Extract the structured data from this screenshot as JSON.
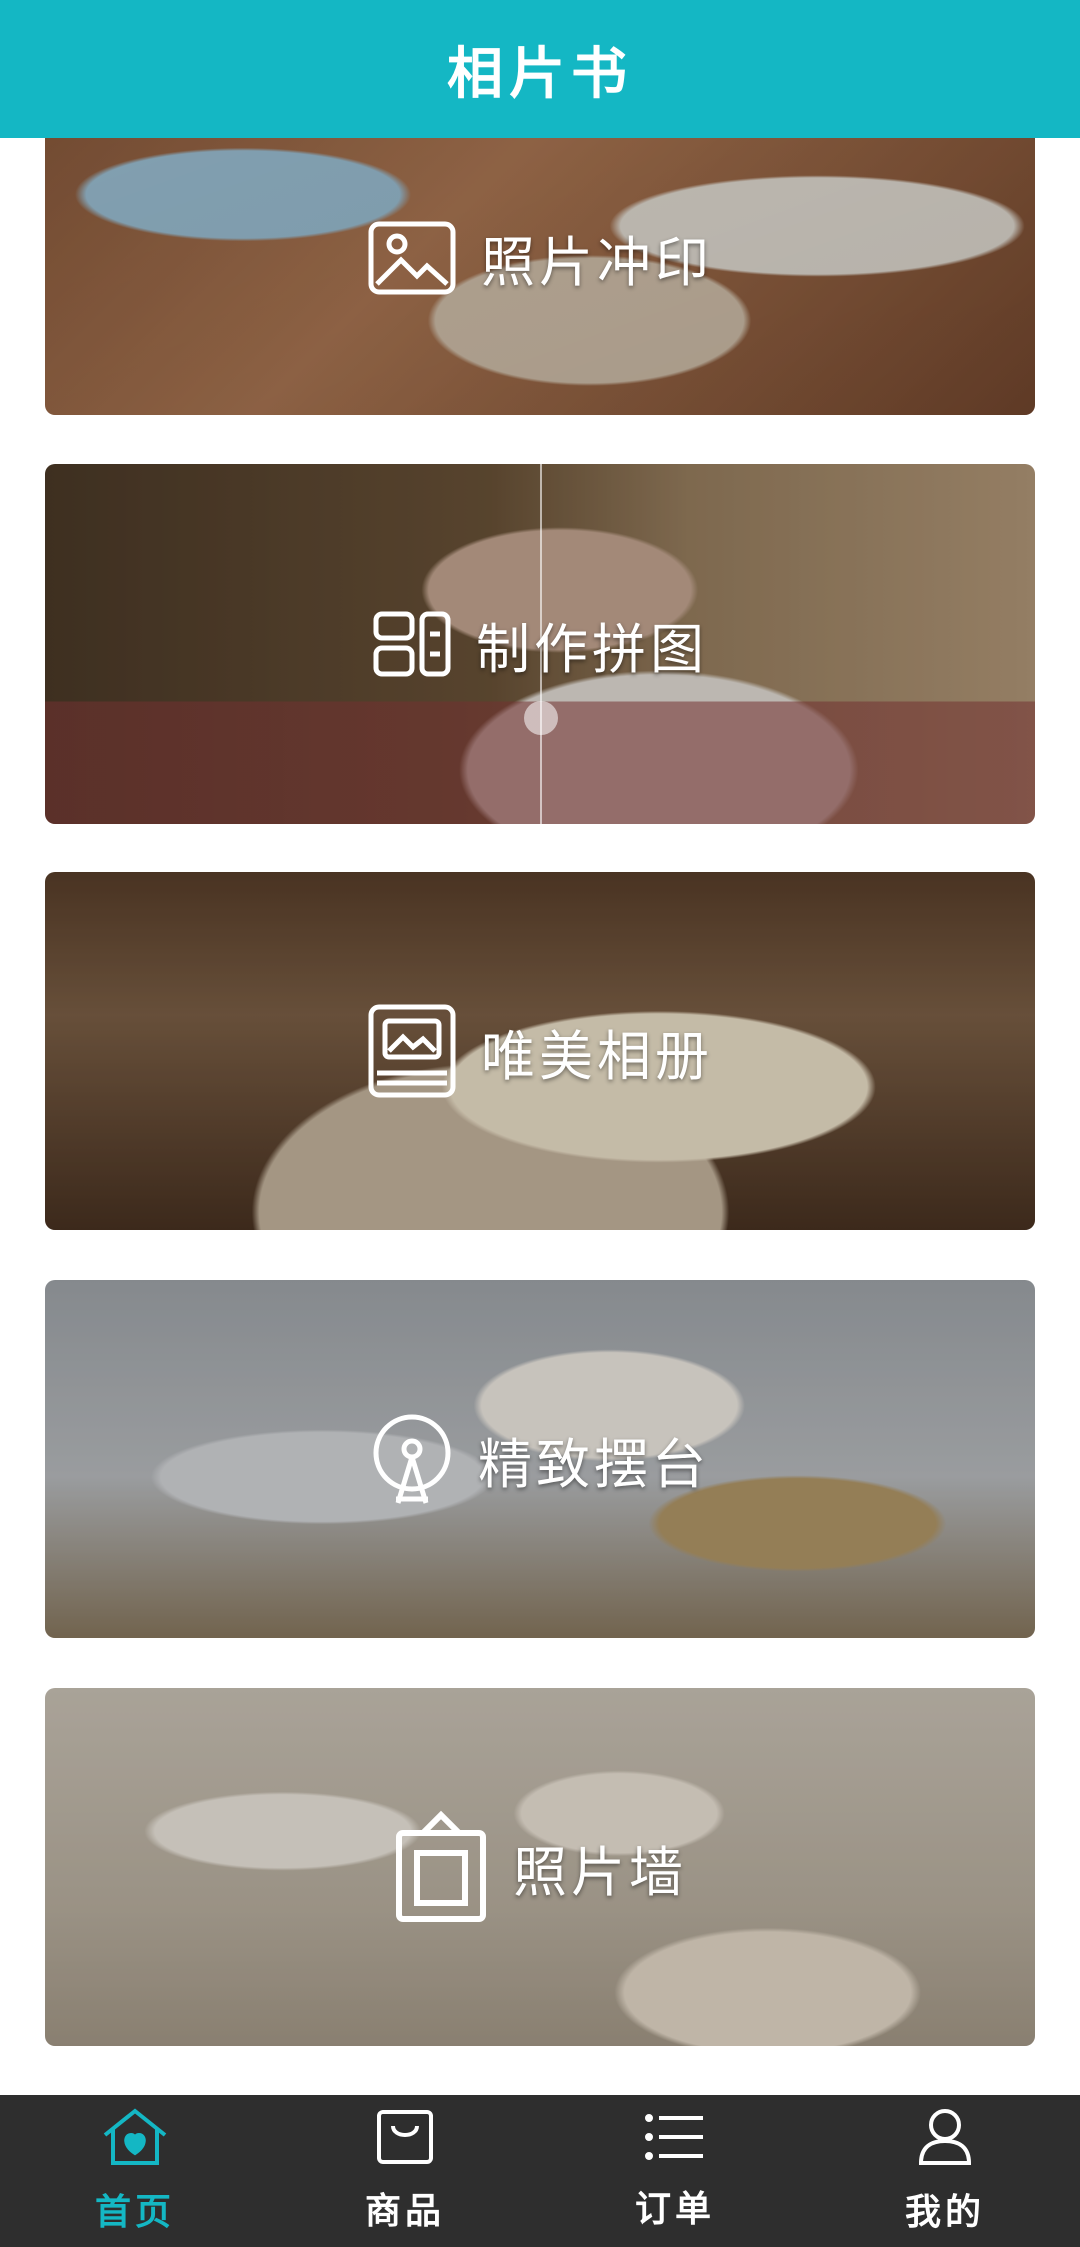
{
  "header": {
    "title": "相片书"
  },
  "cards": [
    {
      "label": "照片冲印",
      "icon": "photo-print-icon"
    },
    {
      "label": "制作拼图",
      "icon": "collage-icon"
    },
    {
      "label": "唯美相册",
      "icon": "album-icon"
    },
    {
      "label": "精致摆台",
      "icon": "photo-stand-icon"
    },
    {
      "label": "照片墙",
      "icon": "photo-wall-icon"
    }
  ],
  "tabbar": {
    "items": [
      {
        "label": "首页",
        "icon": "home-icon",
        "active": true
      },
      {
        "label": "商品",
        "icon": "shopping-bag-icon",
        "active": false
      },
      {
        "label": "订单",
        "icon": "list-icon",
        "active": false
      },
      {
        "label": "我的",
        "icon": "user-icon",
        "active": false
      }
    ]
  },
  "colors": {
    "accent": "#14b7c4",
    "tabbar_bg": "#2e2e2e",
    "header_text": "#ffffff"
  }
}
